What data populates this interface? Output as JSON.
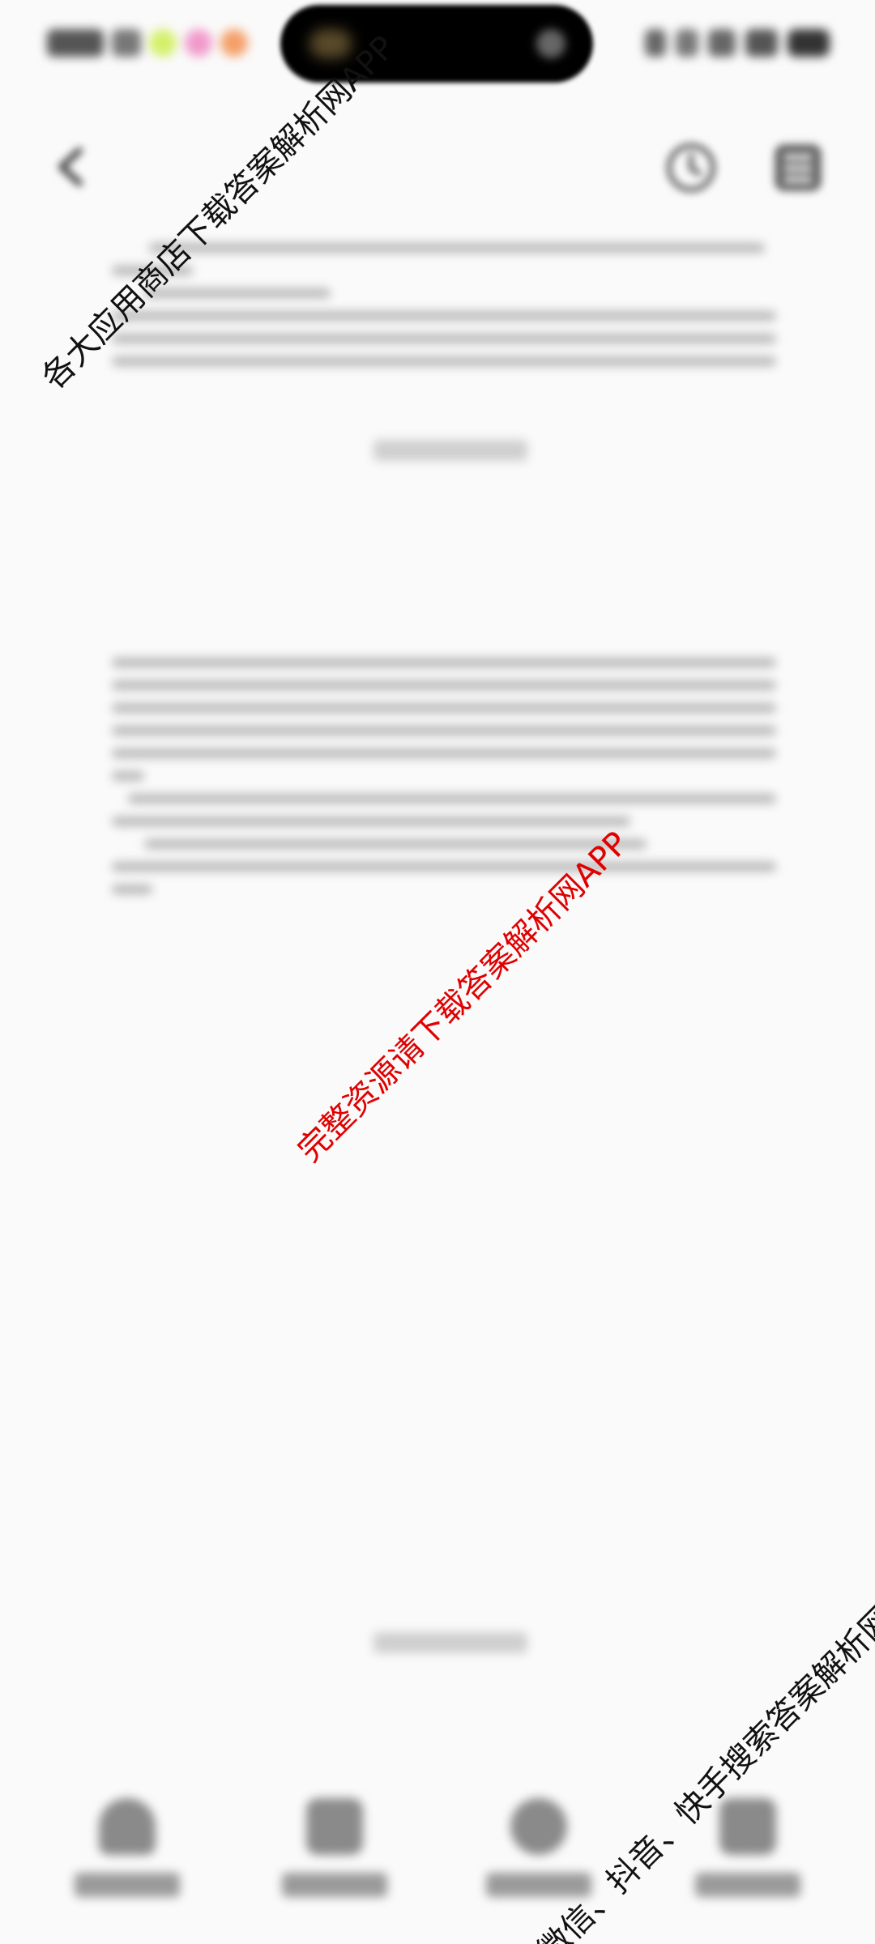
{
  "watermarks": {
    "top_left": "各大应用商店下载答案解析网APP",
    "center": "完整资源请下载答案解析网APP",
    "bottom_right": "微信、抖音、快手搜索答案解析网"
  },
  "colors": {
    "background": "#fafafa",
    "watermark_black": "#111111",
    "watermark_red": "#e00000",
    "camera_pill": "#000000"
  },
  "icons": {
    "back": "arrow-left-icon",
    "history": "clock-icon",
    "menu": "grid-icon",
    "nav_items": [
      "home-icon",
      "table-icon",
      "grid-icon",
      "apps-icon"
    ]
  }
}
